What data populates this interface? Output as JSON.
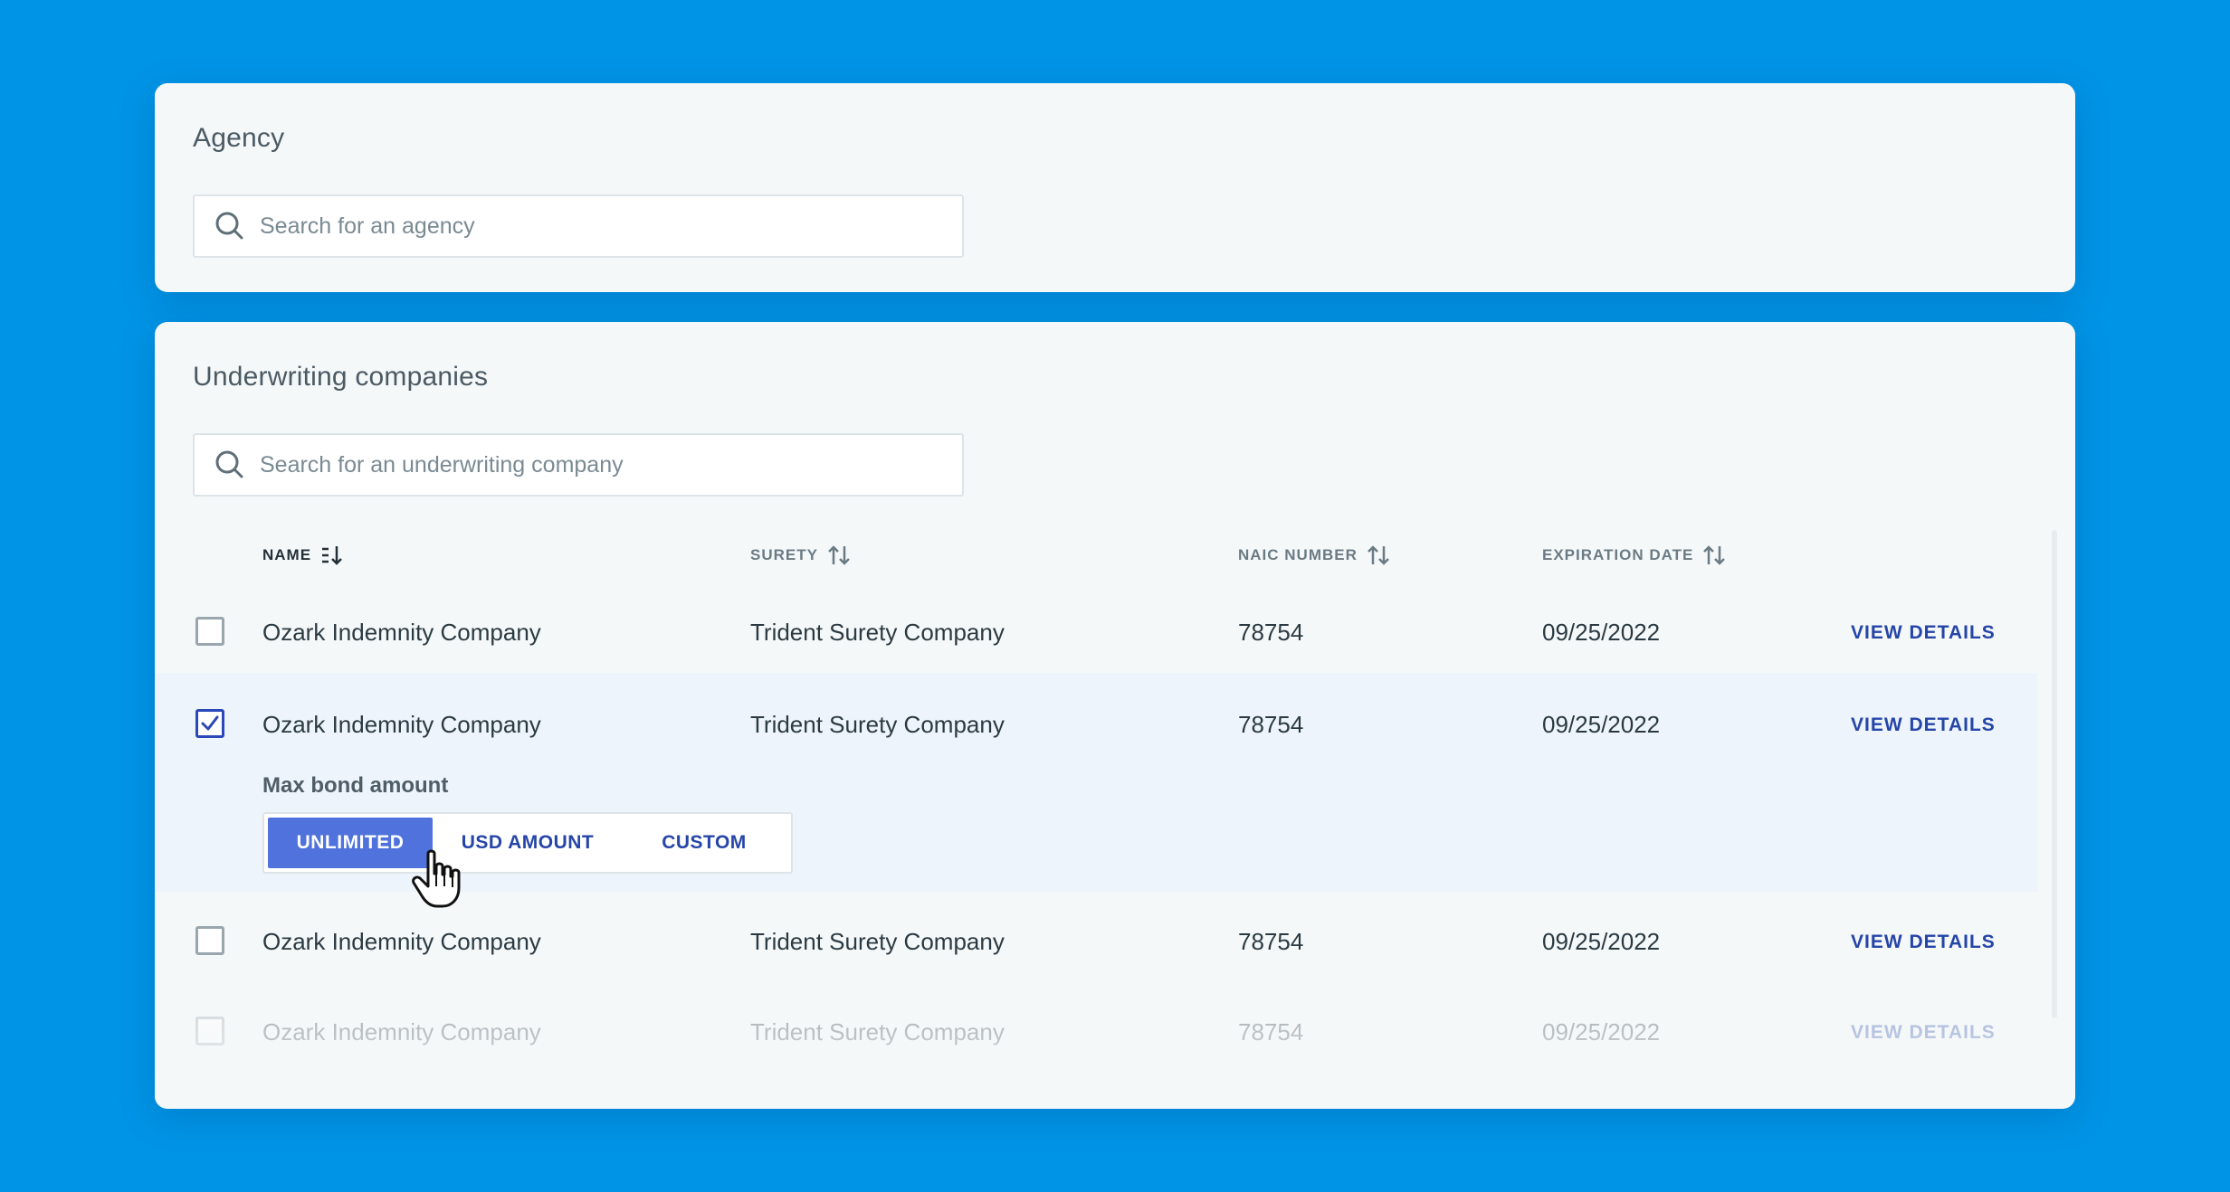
{
  "agency": {
    "title": "Agency",
    "search_placeholder": "Search for an agency"
  },
  "underwriting": {
    "title": "Underwriting companies",
    "search_placeholder": "Search for an underwriting company",
    "columns": {
      "name": "NAME",
      "surety": "SURETY",
      "naic": "NAIC NUMBER",
      "expiration": "EXPIRATION DATE"
    },
    "rows": [
      {
        "name": "Ozark Indemnity Company",
        "surety": "Trident Surety Company",
        "naic": "78754",
        "expiration": "09/25/2022",
        "link": "VIEW DETAILS",
        "checked": false
      },
      {
        "name": "Ozark Indemnity Company",
        "surety": "Trident Surety Company",
        "naic": "78754",
        "expiration": "09/25/2022",
        "link": "VIEW DETAILS",
        "checked": true
      },
      {
        "name": "Ozark Indemnity Company",
        "surety": "Trident Surety Company",
        "naic": "78754",
        "expiration": "09/25/2022",
        "link": "VIEW DETAILS",
        "checked": false
      },
      {
        "name": "Ozark Indemnity Company",
        "surety": "Trident Surety Company",
        "naic": "78754",
        "expiration": "09/25/2022",
        "link": "VIEW DETAILS",
        "checked": false
      }
    ],
    "max_bond": {
      "label": "Max bond amount",
      "options": [
        "UNLIMITED",
        "USD AMOUNT",
        "CUSTOM"
      ],
      "selected": "UNLIMITED"
    }
  },
  "colors": {
    "background": "#0094e6",
    "card": "#f5f8f9",
    "accent": "#4f72dc",
    "link": "#2545a8",
    "selected_row": "#eef4fb"
  },
  "icons": {
    "search": "search-icon",
    "sort_active": "sort-descending-icon",
    "sort": "sort-icon",
    "checkbox_checked": "checkmark-icon",
    "cursor": "hand-pointer-icon"
  }
}
